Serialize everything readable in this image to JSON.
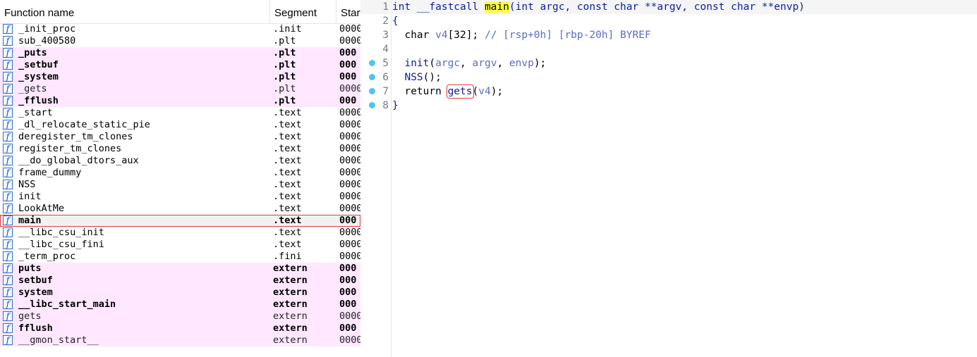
{
  "functions_window": {
    "columns": {
      "name": "Function name",
      "segment": "Segment",
      "start": "Start"
    },
    "icon": "function-icon",
    "icon_glyph": "f",
    "rows": [
      {
        "name": "_init_proc",
        "segment": ".init",
        "start": "0000",
        "style": "normal"
      },
      {
        "name": "sub_400580",
        "segment": ".plt",
        "start": "0000",
        "style": "normal"
      },
      {
        "name": "_puts",
        "segment": ".plt",
        "start": "000",
        "style": "pink-bold"
      },
      {
        "name": "_setbuf",
        "segment": ".plt",
        "start": "000",
        "style": "pink-bold"
      },
      {
        "name": "_system",
        "segment": ".plt",
        "start": "000",
        "style": "pink-bold"
      },
      {
        "name": "_gets",
        "segment": ".plt",
        "start": "0000",
        "style": "pink"
      },
      {
        "name": "_fflush",
        "segment": ".plt",
        "start": "000",
        "style": "pink-bold"
      },
      {
        "name": "_start",
        "segment": ".text",
        "start": "0000",
        "style": "normal"
      },
      {
        "name": "_dl_relocate_static_pie",
        "segment": ".text",
        "start": "0000",
        "style": "normal"
      },
      {
        "name": "deregister_tm_clones",
        "segment": ".text",
        "start": "0000",
        "style": "normal"
      },
      {
        "name": "register_tm_clones",
        "segment": ".text",
        "start": "0000",
        "style": "normal"
      },
      {
        "name": "__do_global_dtors_aux",
        "segment": ".text",
        "start": "0000",
        "style": "normal"
      },
      {
        "name": "frame_dummy",
        "segment": ".text",
        "start": "0000",
        "style": "normal"
      },
      {
        "name": "NSS",
        "segment": ".text",
        "start": "0000",
        "style": "normal"
      },
      {
        "name": "init",
        "segment": ".text",
        "start": "0000",
        "style": "normal"
      },
      {
        "name": "LookAtMe",
        "segment": ".text",
        "start": "0000",
        "style": "normal"
      },
      {
        "name": "main",
        "segment": ".text",
        "start": "000",
        "style": "selected"
      },
      {
        "name": "__libc_csu_init",
        "segment": ".text",
        "start": "0000",
        "style": "normal"
      },
      {
        "name": "__libc_csu_fini",
        "segment": ".text",
        "start": "0000",
        "style": "normal"
      },
      {
        "name": "_term_proc",
        "segment": ".fini",
        "start": "0000",
        "style": "normal"
      },
      {
        "name": "puts",
        "segment": "extern",
        "start": "000",
        "style": "pink-bold"
      },
      {
        "name": "setbuf",
        "segment": "extern",
        "start": "000",
        "style": "pink-bold"
      },
      {
        "name": "system",
        "segment": "extern",
        "start": "000",
        "style": "pink-bold"
      },
      {
        "name": "__libc_start_main",
        "segment": "extern",
        "start": "000",
        "style": "pink-bold"
      },
      {
        "name": "gets",
        "segment": "extern",
        "start": "0000",
        "style": "pink"
      },
      {
        "name": "fflush",
        "segment": "extern",
        "start": "000",
        "style": "pink-bold"
      },
      {
        "name": "__gmon_start__",
        "segment": "extern",
        "start": "0000",
        "style": "pink"
      }
    ]
  },
  "pseudocode_window": {
    "breakpoint_icon": "breakpoint-dot-icon",
    "lines": [
      {
        "no": "1",
        "dot": false,
        "current": true,
        "tokens": [
          {
            "t": "int __fastcall ",
            "c": "kw"
          },
          {
            "t": "main",
            "c": "hl"
          },
          {
            "t": "(int argc, const char **argv, const char **envp)",
            "c": "kw"
          }
        ]
      },
      {
        "no": "2",
        "dot": false,
        "tokens": [
          {
            "t": "{",
            "c": "kw"
          }
        ]
      },
      {
        "no": "3",
        "dot": false,
        "tokens": [
          {
            "t": "  char ",
            "c": ""
          },
          {
            "t": "v4",
            "c": "var"
          },
          {
            "t": "[32]; ",
            "c": ""
          },
          {
            "t": "// [rsp+0h] [rbp-20h] BYREF",
            "c": "cmt"
          }
        ]
      },
      {
        "no": "4",
        "dot": false,
        "tokens": []
      },
      {
        "no": "5",
        "dot": true,
        "tokens": [
          {
            "t": "  init",
            "c": "fn"
          },
          {
            "t": "(",
            "c": ""
          },
          {
            "t": "argc",
            "c": "var"
          },
          {
            "t": ", ",
            "c": ""
          },
          {
            "t": "argv",
            "c": "var"
          },
          {
            "t": ", ",
            "c": ""
          },
          {
            "t": "envp",
            "c": "var"
          },
          {
            "t": ");",
            "c": ""
          }
        ]
      },
      {
        "no": "6",
        "dot": true,
        "tokens": [
          {
            "t": "  NSS",
            "c": "fn"
          },
          {
            "t": "();",
            "c": ""
          }
        ]
      },
      {
        "no": "7",
        "dot": true,
        "tokens": [
          {
            "t": "  return ",
            "c": ""
          },
          {
            "t": "gets",
            "c": "fn boxed"
          },
          {
            "t": "(",
            "c": ""
          },
          {
            "t": "v4",
            "c": "var"
          },
          {
            "t": ");",
            "c": ""
          }
        ]
      },
      {
        "no": "8",
        "dot": true,
        "tokens": [
          {
            "t": "}",
            "c": "kw"
          }
        ]
      }
    ]
  },
  "colors": {
    "pink_row": "#ffe8ff",
    "selection_outline": "#e53935",
    "keyword": "#0a1fa0",
    "variable": "#5b6cc8",
    "highlight": "#ffff40",
    "breakpoint": "#4fc3f7"
  }
}
